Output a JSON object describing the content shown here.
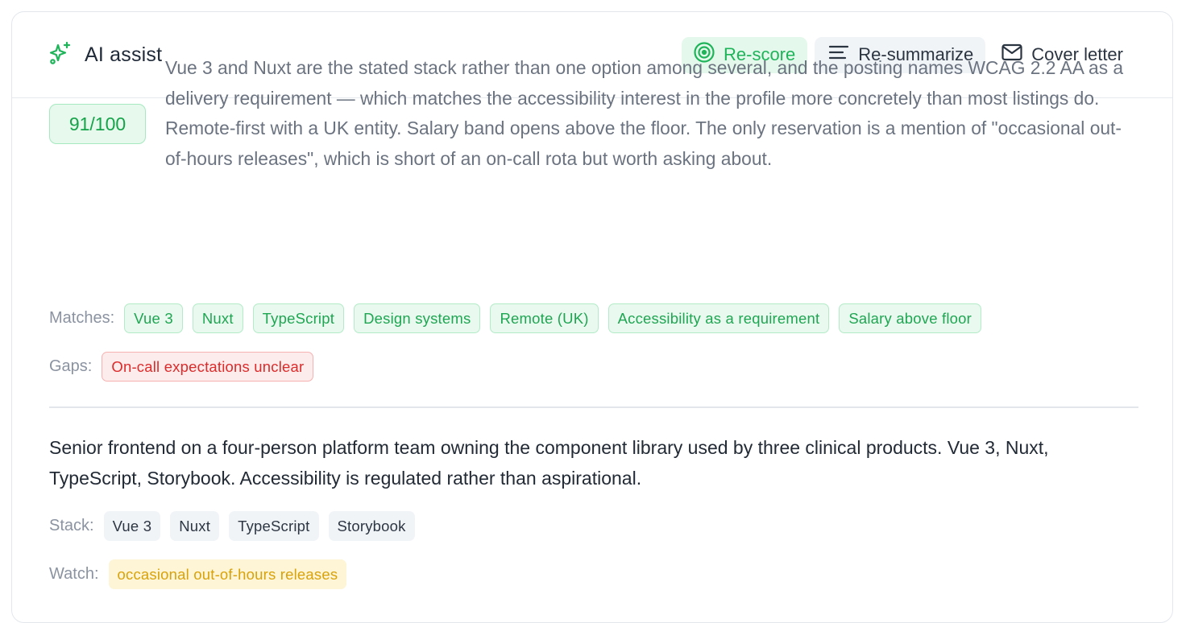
{
  "header": {
    "title": "AI assist",
    "icon": "sparkles-icon",
    "accent": "#1fb45a",
    "actions": {
      "rescore": "Re-score",
      "resummarize": "Re-summarize",
      "cover_letter": "Cover letter"
    }
  },
  "score": {
    "value": "91/100",
    "text": "Vue 3 and Nuxt are the stated stack rather than one option among several, and the posting names WCAG 2.2 AA as a delivery requirement — which matches the accessibility interest in the profile more concretely than most listings do. Remote-first with a UK entity. Salary band opens above the floor. The only reservation is a mention of \"occasional out-of-hours releases\", which is short of an on-call rota but worth asking about."
  },
  "matches": {
    "label": "Matches:",
    "items": [
      "Vue 3",
      "Nuxt",
      "TypeScript",
      "Design systems",
      "Remote (UK)",
      "Accessibility as a requirement",
      "Salary above floor"
    ]
  },
  "gaps": {
    "label": "Gaps:",
    "items": [
      "On-call expectations unclear"
    ]
  },
  "summary": {
    "text": "Senior frontend on a four-person platform team owning the component library used by three clinical products. Vue 3, Nuxt, TypeScript, Storybook. Accessibility is regulated rather than aspirational."
  },
  "stack": {
    "label": "Stack:",
    "items": [
      "Vue 3",
      "Nuxt",
      "TypeScript",
      "Storybook"
    ]
  },
  "watch": {
    "label": "Watch:",
    "items": [
      "occasional out-of-hours releases"
    ]
  }
}
